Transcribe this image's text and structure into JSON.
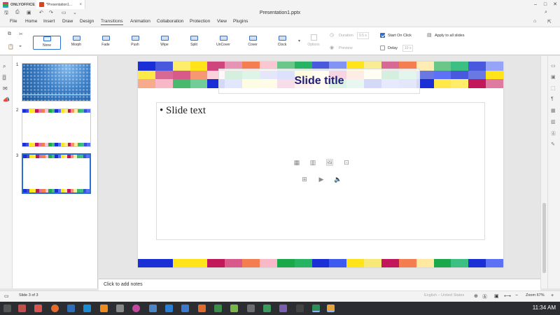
{
  "app": {
    "name": "ONLYOFFICE",
    "tab_title": "*Presentation1...",
    "doc_name": "Presentation1.pptx"
  },
  "menu": {
    "tabs": [
      "File",
      "Home",
      "Insert",
      "Draw",
      "Design",
      "Transitions",
      "Animation",
      "Collaboration",
      "Protection",
      "View",
      "Plugins"
    ],
    "active": "Transitions"
  },
  "ribbon": {
    "effects": [
      {
        "label": "None",
        "selected": true
      },
      {
        "label": "Morph"
      },
      {
        "label": "Fade"
      },
      {
        "label": "Push"
      },
      {
        "label": "Wipe"
      },
      {
        "label": "Split"
      },
      {
        "label": "UnCover"
      },
      {
        "label": "Cover"
      },
      {
        "label": "Clock"
      }
    ],
    "options_label": "Options",
    "duration_label": "Duration",
    "duration_value": "0.5 s",
    "preview_label": "Preview",
    "start_on_click_label": "Start On Click",
    "start_on_click_checked": true,
    "delay_label": "Delay",
    "delay_value": "10 s",
    "apply_all_label": "Apply to all slides"
  },
  "thumbnails": [
    {
      "number": "1",
      "style": "blue"
    },
    {
      "number": "2",
      "style": "strips"
    },
    {
      "number": "3",
      "style": "strips",
      "selected": true
    }
  ],
  "slide": {
    "title": "Slide title",
    "bullet": "•",
    "body": "Slide text"
  },
  "notes": {
    "placeholder": "Click to add notes"
  },
  "status": {
    "slide_info": "Slide 3 of 3",
    "language": "English – United States",
    "zoom": "Zoom 67%"
  },
  "taskbar": {
    "time": "11:34 AM"
  },
  "colors": {
    "accent": "#2a6fd1",
    "active_tab_underline": "#c0392b",
    "title_text": "#1f1d78"
  },
  "strip_colors": [
    "#1a2fd6",
    "#1a2fd6",
    "#ffe41a",
    "#ffe41a",
    "#c2185b",
    "#d75a8a",
    "#f47e4f",
    "#f9b8c7",
    "#1aa84a",
    "#26b362",
    "#1a2fd6",
    "#3d5bf0",
    "#ffe41a",
    "#f7e978",
    "#c2185b",
    "#f47e4f",
    "#ffe9a0",
    "#1aa84a",
    "#3cbf83",
    "#1a2fd6",
    "#5c71f5"
  ]
}
